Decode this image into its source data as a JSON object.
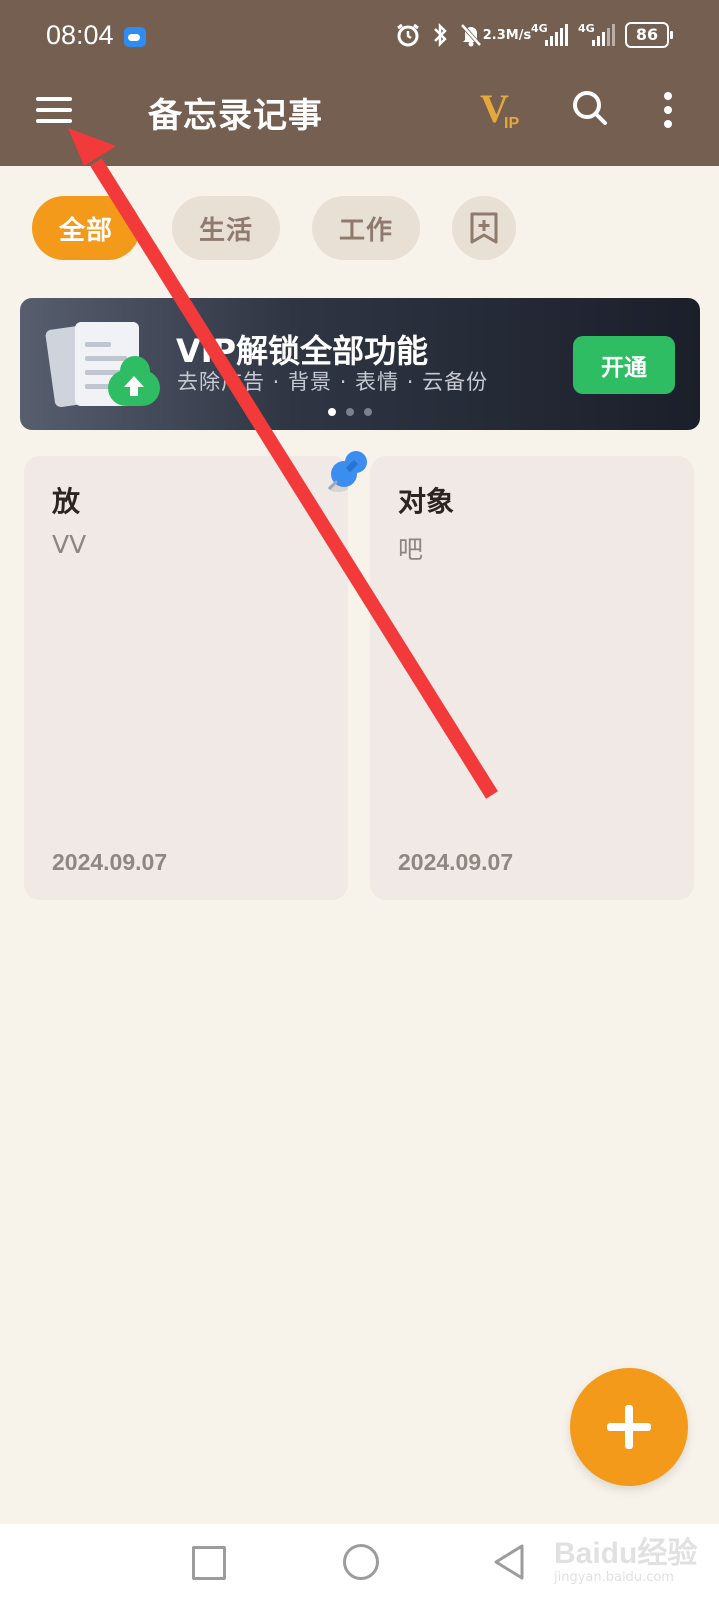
{
  "status_bar": {
    "time": "08:04",
    "net_speed_value": "2.3",
    "net_speed_unit": "M/s",
    "signal1_label": "4G",
    "signal2_label": "4G",
    "battery": "86",
    "icons": [
      "weather-icon",
      "alarm-icon",
      "bluetooth-icon",
      "mute-icon"
    ]
  },
  "app_bar": {
    "title": "备忘录记事",
    "vip_label": "V",
    "vip_sub": "IP"
  },
  "tabs": [
    {
      "label": "全部",
      "active": true
    },
    {
      "label": "生活",
      "active": false
    },
    {
      "label": "工作",
      "active": false
    }
  ],
  "banner": {
    "title": "VIP解锁全部功能",
    "subtitle": "去除广告 · 背景 · 表情 · 云备份",
    "button": "开通",
    "page_count": 3,
    "active_page": 1
  },
  "notes": [
    {
      "title": "放",
      "body": "VV",
      "date": "2024.09.07",
      "pinned": true
    },
    {
      "title": "对象",
      "body": "吧",
      "date": "2024.09.07",
      "pinned": false
    }
  ],
  "watermark": {
    "main": "Baidu经验",
    "sub": "jingyan.baidu.com"
  },
  "colors": {
    "app_bar": "#745f51",
    "accent": "#f39a1b",
    "green": "#2ebd63",
    "background": "#f8f3ea",
    "note_card": "#f0e9e5",
    "annotation_arrow": "#f23a3a"
  }
}
